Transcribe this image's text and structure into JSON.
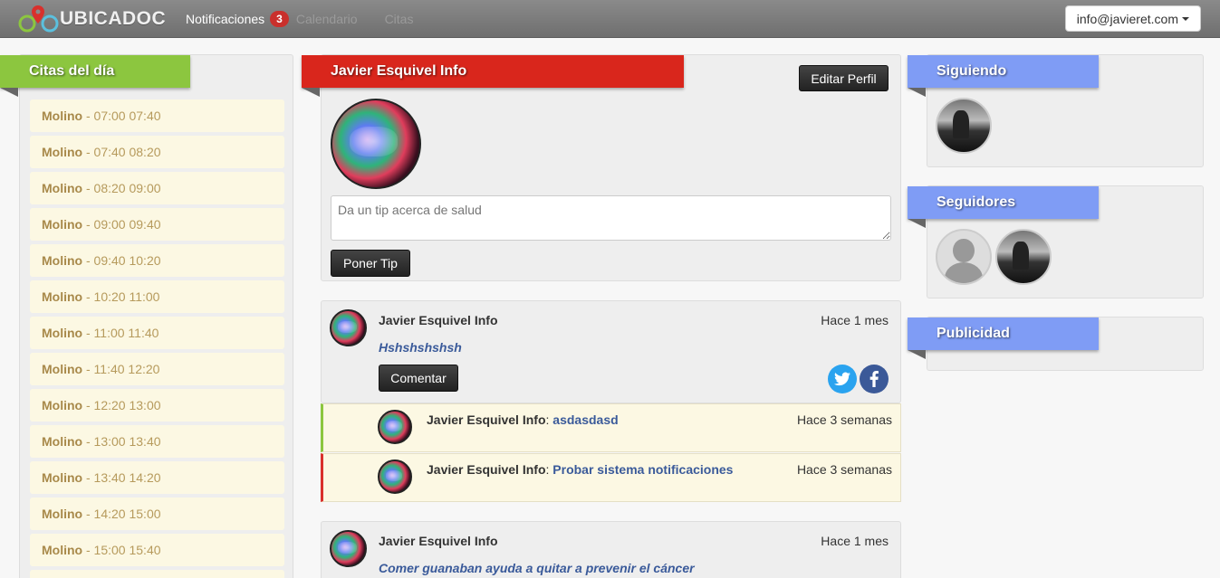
{
  "brand": {
    "name": "UBICADOC"
  },
  "nav": {
    "items": [
      {
        "label": "Notificaciones",
        "badge": "3"
      },
      {
        "label": "Calendario"
      },
      {
        "label": "Citas"
      }
    ]
  },
  "account": {
    "email": "info@javieret.com"
  },
  "citas": {
    "title": "Citas del día",
    "items": [
      {
        "place": "Molino",
        "time": "- 07:00 07:40"
      },
      {
        "place": "Molino",
        "time": "- 07:40 08:20"
      },
      {
        "place": "Molino",
        "time": "- 08:20 09:00"
      },
      {
        "place": "Molino",
        "time": "- 09:00 09:40"
      },
      {
        "place": "Molino",
        "time": "- 09:40 10:20"
      },
      {
        "place": "Molino",
        "time": "- 10:20 11:00"
      },
      {
        "place": "Molino",
        "time": "- 11:00 11:40"
      },
      {
        "place": "Molino",
        "time": "- 11:40 12:20"
      },
      {
        "place": "Molino",
        "time": "- 12:20 13:00"
      },
      {
        "place": "Molino",
        "time": "- 13:00 13:40"
      },
      {
        "place": "Molino",
        "time": "- 13:40 14:20"
      },
      {
        "place": "Molino",
        "time": "- 14:20 15:00"
      },
      {
        "place": "Molino",
        "time": "- 15:00 15:40"
      }
    ]
  },
  "profile": {
    "name": "Javier Esquivel Info",
    "edit_label": "Editar Perfil",
    "tip_placeholder": "Da un tip acerca de salud",
    "tip_button": "Poner Tip"
  },
  "posts": [
    {
      "author": "Javier Esquivel Info",
      "time": "Hace 1 mes",
      "text": "Hshshshshsh",
      "comment_label": "Comentar",
      "comments": [
        {
          "author": "Javier Esquivel Info",
          "sep": ": ",
          "text": "asdasdasd",
          "time": "Hace 3 semanas",
          "accent": "#8cc63f"
        },
        {
          "author": "Javier Esquivel Info",
          "sep": ": ",
          "text": "Probar sistema notificaciones",
          "time": "Hace 3 semanas",
          "accent": "#d9302c"
        }
      ]
    },
    {
      "author": "Javier Esquivel Info",
      "time": "Hace 1 mes",
      "text": "Comer guanaban ayuda a quitar a prevenir el cáncer"
    }
  ],
  "sidebar": {
    "siguiendo": {
      "title": "Siguiendo"
    },
    "seguidores": {
      "title": "Seguidores"
    },
    "publicidad": {
      "title": "Publicidad"
    }
  },
  "colors": {
    "citas_ribbon": "#8cc63f",
    "profile_ribbon": "#d9261c",
    "sidebar_ribbon": "#7f9cf5",
    "twitter": "#2aa3ef",
    "facebook": "#3b5998"
  },
  "icons": [
    "map-pin-icon",
    "twitter-icon",
    "facebook-icon",
    "caret-down-icon"
  ]
}
